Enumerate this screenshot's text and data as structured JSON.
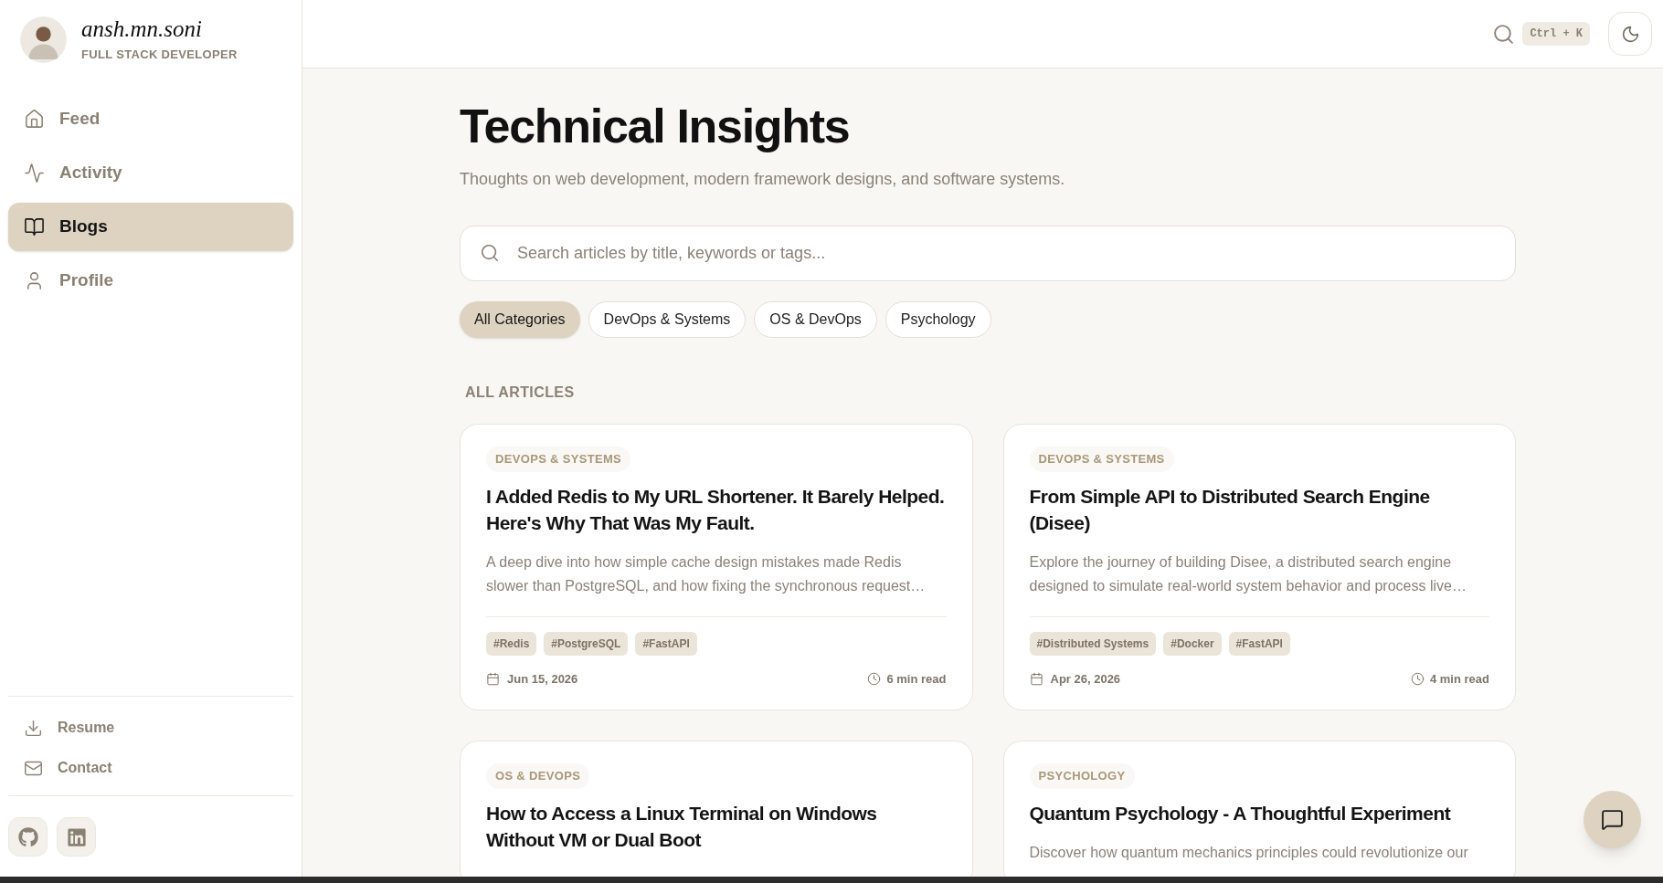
{
  "profile": {
    "name": "ansh.mn.soni",
    "role": "FULL STACK DEVELOPER"
  },
  "nav": [
    {
      "label": "Feed",
      "selected": false
    },
    {
      "label": "Activity",
      "selected": false
    },
    {
      "label": "Blogs",
      "selected": true
    },
    {
      "label": "Profile",
      "selected": false
    }
  ],
  "footer_links": [
    {
      "label": "Resume"
    },
    {
      "label": "Contact"
    }
  ],
  "socials": [
    {
      "kind": "github"
    },
    {
      "kind": "linkedin"
    }
  ],
  "topbar": {
    "shortcut": "Ctrl + K"
  },
  "header": {
    "title": "Technical Insights",
    "subtitle": "Thoughts on web development, modern framework designs, and software systems."
  },
  "search": {
    "placeholder": "Search articles by title, keywords or tags..."
  },
  "filters": [
    {
      "label": "All Categories",
      "selected": true
    },
    {
      "label": "DevOps & Systems",
      "selected": false
    },
    {
      "label": "OS & DevOps",
      "selected": false
    },
    {
      "label": "Psychology",
      "selected": false
    }
  ],
  "section_title": "ALL ARTICLES",
  "articles": [
    {
      "category": "DEVOPS & SYSTEMS",
      "title": "I Added Redis to My URL Shortener. It Barely Helped. Here's Why That Was My Fault.",
      "excerpt": "A deep dive into how simple cache design mistakes made Redis slower than PostgreSQL, and how fixing the synchronous request…",
      "tags": [
        "#Redis",
        "#PostgreSQL",
        "#FastAPI"
      ],
      "date": "Jun 15, 2026",
      "read_time": "6 min read"
    },
    {
      "category": "DEVOPS & SYSTEMS",
      "title": "From Simple API to Distributed Search Engine (Disee)",
      "excerpt": "Explore the journey of building Disee, a distributed search engine designed to simulate real-world system behavior and process live…",
      "tags": [
        "#Distributed Systems",
        "#Docker",
        "#FastAPI"
      ],
      "date": "Apr 26, 2026",
      "read_time": "4 min read"
    },
    {
      "category": "OS & DEVOPS",
      "title": "How to Access a Linux Terminal on Windows Without VM or Dual Boot"
    },
    {
      "category": "PSYCHOLOGY",
      "title": "Quantum Psychology - A Thoughtful Experiment",
      "excerpt": "Discover how quantum mechanics principles could revolutionize our"
    }
  ]
}
